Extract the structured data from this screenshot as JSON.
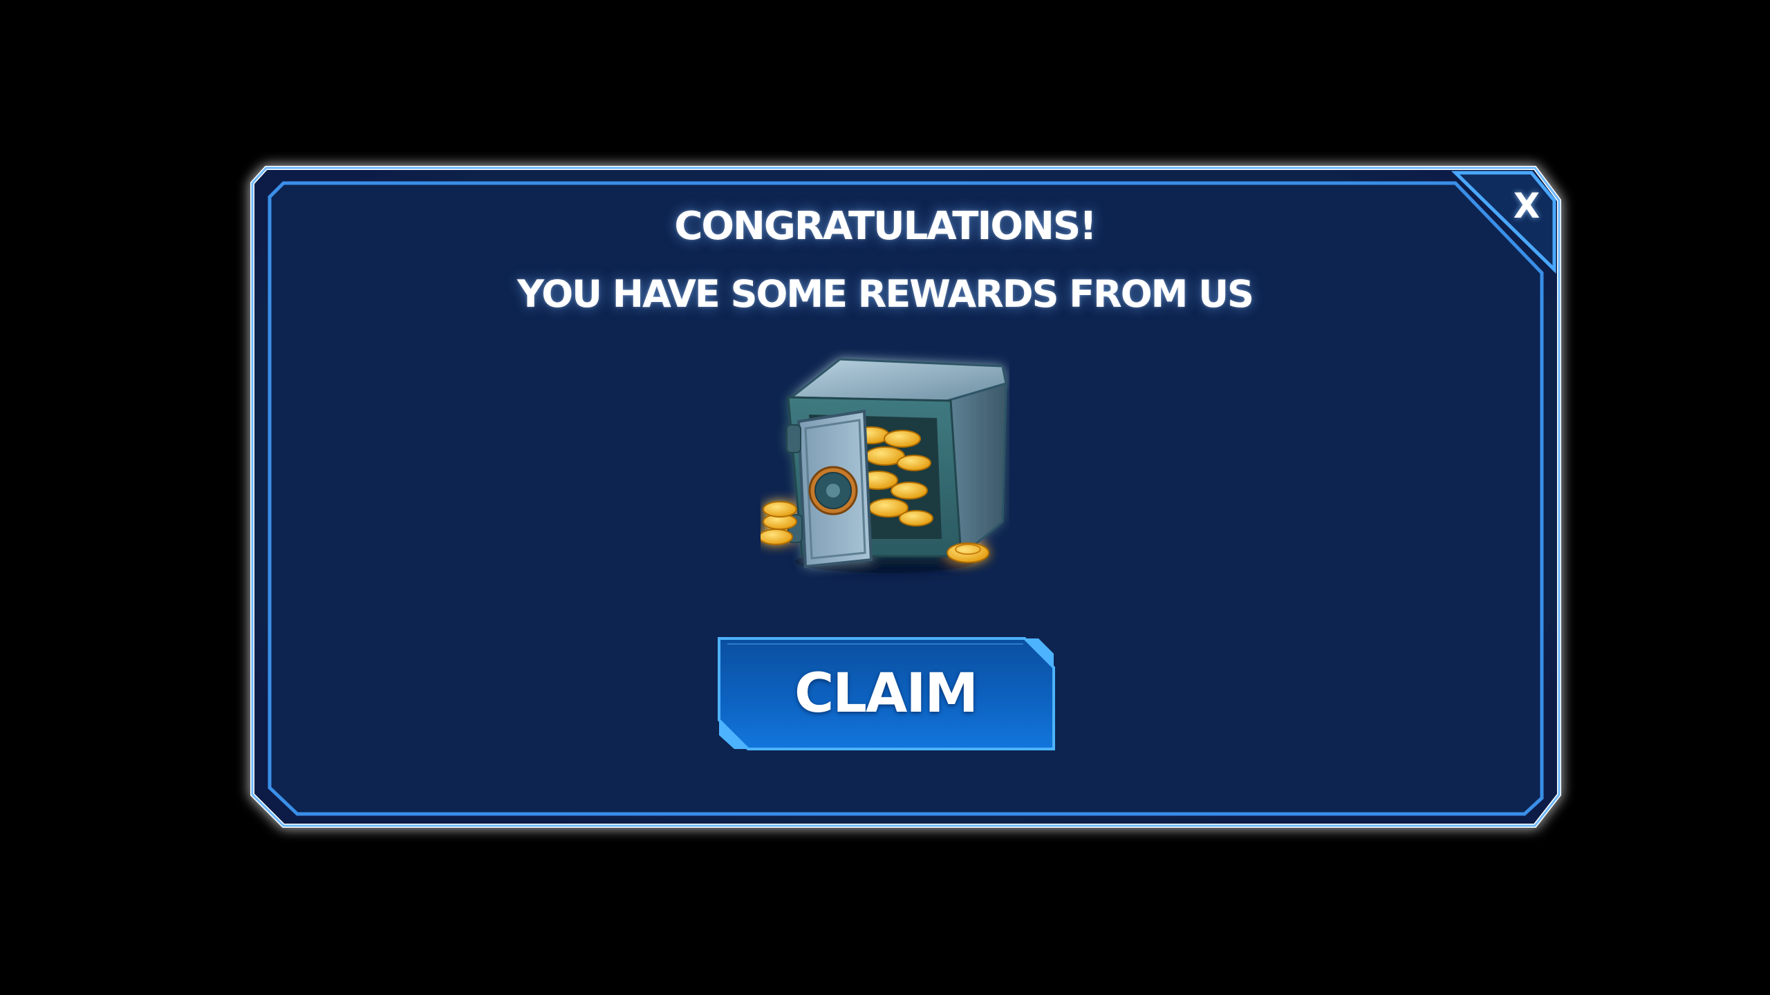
{
  "dialog": {
    "title": "CONGRATULATIONS!",
    "subtitle": "YOU HAVE SOME REWARDS FROM US",
    "close_label": "X",
    "claim_label": "CLAIM",
    "reward_icon": "safe-with-gold-coins-icon"
  },
  "colors": {
    "background": "#000000",
    "panel_fill": "#0d2450",
    "frame_glow": "#4aa8ff",
    "frame_outline": "#ffffff",
    "button_fill": "#0d62c0",
    "button_edge": "#4db3ff",
    "coin_gold": "#f6b617"
  }
}
